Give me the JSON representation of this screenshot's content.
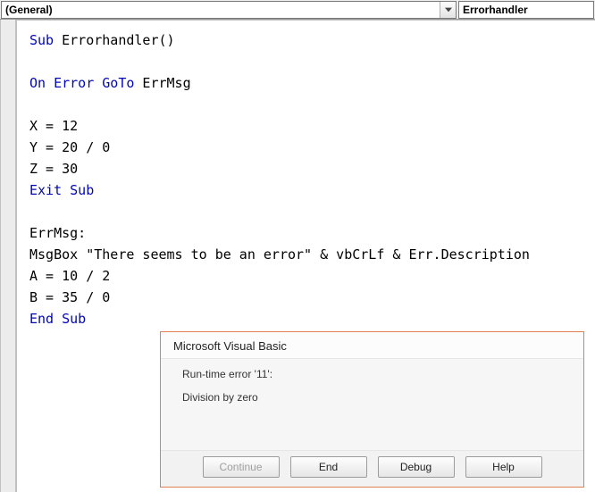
{
  "toolbar": {
    "object_selector": "(General)",
    "procedure_selector": "Errorhandler"
  },
  "code": {
    "tokens": [
      [
        {
          "t": "Sub",
          "c": "kw"
        },
        {
          "t": " Errorhandler()",
          "c": "txt"
        }
      ],
      [],
      [
        {
          "t": "On Error GoTo",
          "c": "kw"
        },
        {
          "t": " ErrMsg",
          "c": "txt"
        }
      ],
      [],
      [
        {
          "t": "X = 12",
          "c": "txt"
        }
      ],
      [
        {
          "t": "Y = 20 / 0",
          "c": "txt"
        }
      ],
      [
        {
          "t": "Z = 30",
          "c": "txt"
        }
      ],
      [
        {
          "t": "Exit Sub",
          "c": "kw"
        }
      ],
      [],
      [
        {
          "t": "ErrMsg:",
          "c": "txt"
        }
      ],
      [
        {
          "t": "MsgBox ",
          "c": "txt"
        },
        {
          "t": "\"There seems to be an error\"",
          "c": "str"
        },
        {
          "t": " & vbCrLf & Err.Description ",
          "c": "txt"
        }
      ],
      [
        {
          "t": "A = 10 / 2",
          "c": "txt"
        }
      ],
      [
        {
          "t": "B = 35 / 0",
          "c": "txt"
        }
      ],
      [
        {
          "t": "End Sub",
          "c": "kw"
        }
      ]
    ]
  },
  "dialog": {
    "title": "Microsoft Visual Basic",
    "error_line1": "Run-time error '11':",
    "error_line2": "Division by zero",
    "buttons": {
      "continue": "Continue",
      "end": "End",
      "debug": "Debug",
      "help": "Help"
    }
  },
  "icons": {
    "chevron_down": "chevron-down-icon"
  }
}
